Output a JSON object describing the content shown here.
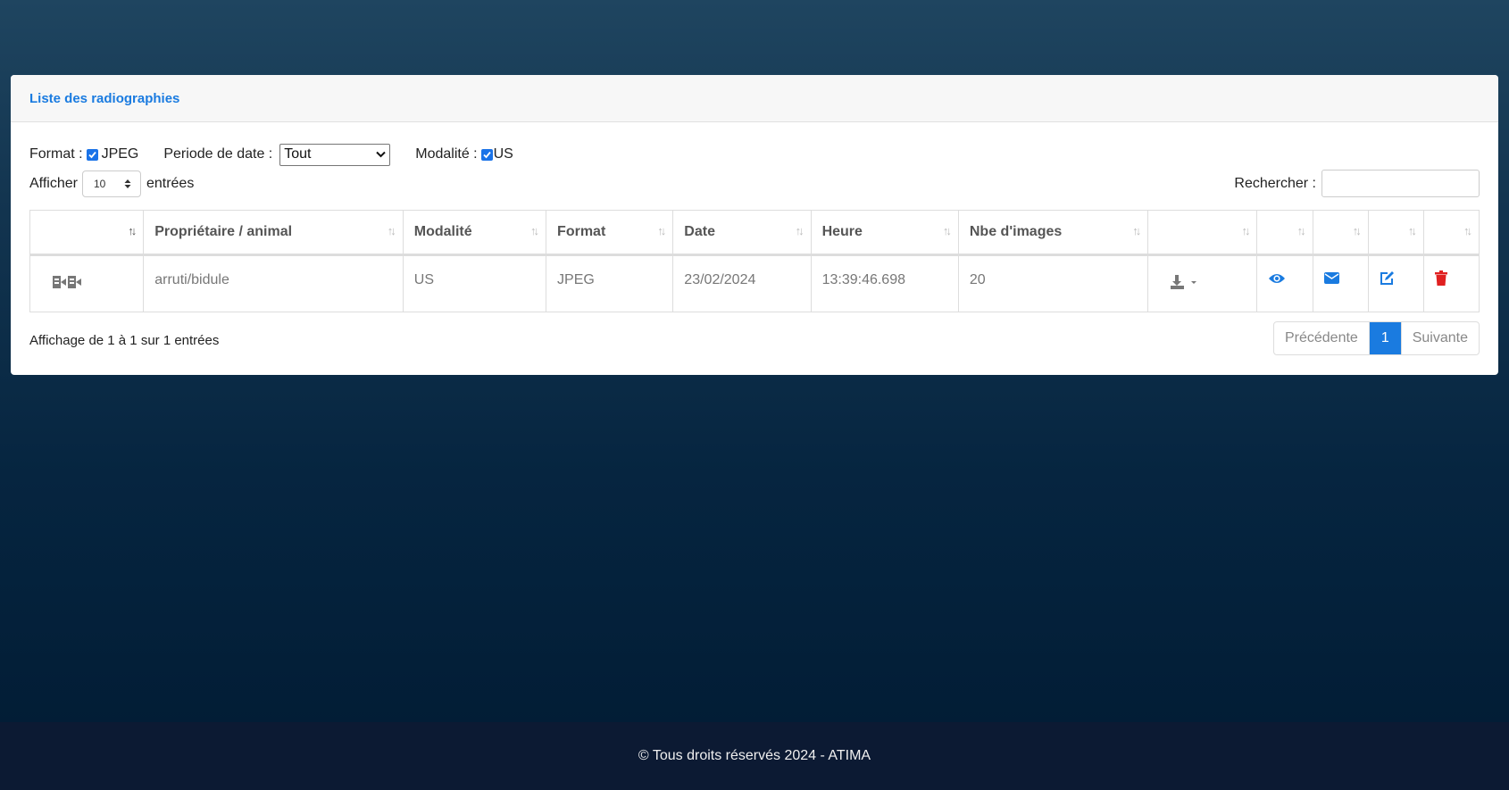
{
  "card": {
    "title": "Liste des radiographies"
  },
  "filters": {
    "format_label": "Format :",
    "format_option": "JPEG",
    "period_label": "Periode de date :",
    "period_value": "Tout",
    "modality_label": "Modalité :",
    "modality_option": "US"
  },
  "length": {
    "prefix": "Afficher",
    "value": "10",
    "suffix": "entrées"
  },
  "search": {
    "label": "Rechercher :",
    "value": ""
  },
  "table": {
    "headers": [
      "",
      "Propriétaire / animal",
      "Modalité",
      "Format",
      "Date",
      "Heure",
      "Nbe d'images",
      "",
      "",
      "",
      "",
      ""
    ],
    "rows": [
      {
        "owner": "arruti/bidule",
        "modality": "US",
        "format": "JPEG",
        "date": "23/02/2024",
        "time": "13:39:46.698",
        "images": "20"
      }
    ]
  },
  "info": "Affichage de 1 à 1 sur 1 entrées",
  "pagination": {
    "prev": "Précédente",
    "current": "1",
    "next": "Suivante"
  },
  "footer": {
    "text": "© Tous droits réservés 2024 - ATIMA"
  },
  "colors": {
    "accent": "#1a7be0",
    "delete": "#e02020",
    "icon_gray": "#777777"
  }
}
